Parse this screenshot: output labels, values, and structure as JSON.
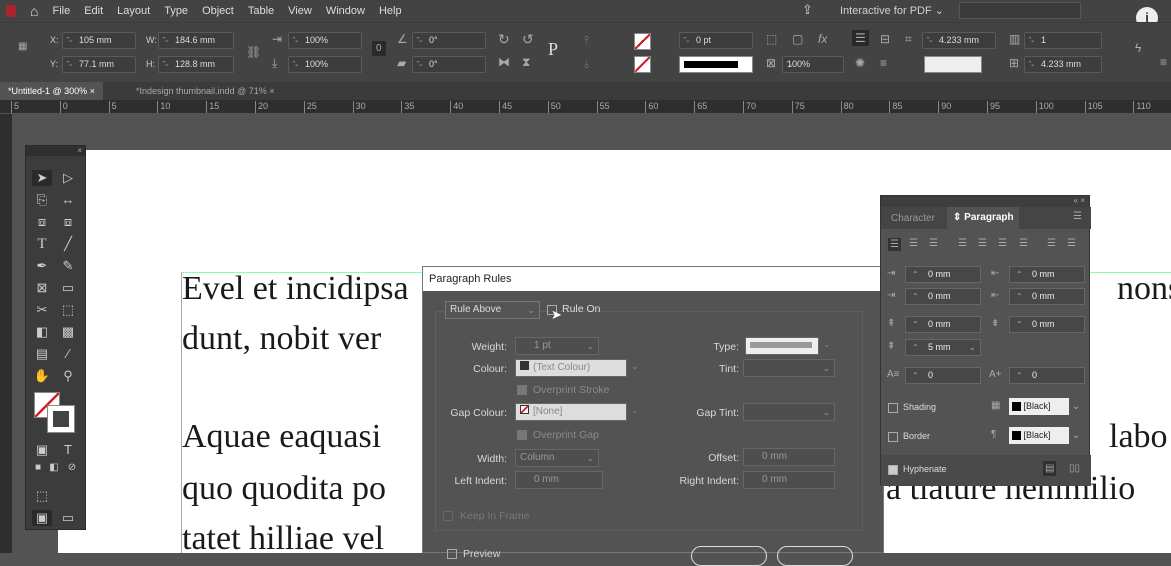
{
  "menubar": {
    "items": [
      "File",
      "Edit",
      "Layout",
      "Type",
      "Object",
      "Table",
      "View",
      "Window",
      "Help"
    ],
    "workspace": "Interactive for PDF"
  },
  "control": {
    "x": "105 mm",
    "y": "77.1 mm",
    "w": "184.6 mm",
    "h": "128.8 mm",
    "x_label": "X:",
    "y_label": "Y:",
    "w_label": "W:",
    "h_label": "H:",
    "scale_x": "100%",
    "scale_y": "100%",
    "rotate": "0°",
    "shear": "0°",
    "stroke_weight": "0 pt",
    "opacity": "100%",
    "gutter": "4.233 mm",
    "columns": "1",
    "col_gutter": "4.233 mm"
  },
  "tabs": [
    {
      "label": "*Untitled-1 @ 300%",
      "active": true
    },
    {
      "label": "*Indesign thumbnail.indd @ 71%",
      "active": false
    }
  ],
  "ruler": [
    "5",
    "0",
    "5",
    "10",
    "15",
    "20",
    "25",
    "30",
    "35",
    "40",
    "45",
    "50",
    "55",
    "60",
    "65",
    "70",
    "75",
    "80",
    "85",
    "90",
    "95",
    "100",
    "105",
    "110"
  ],
  "document": {
    "lines_left": [
      "Evel et incidipsa",
      "dunt, nobit ver",
      "Aquae eaquasi",
      "quo quodita po",
      "tatet hilliae vel"
    ],
    "lines_right": [
      "nons",
      "labo",
      "a tiature henimilio"
    ]
  },
  "dialog": {
    "title": "Paragraph Rules",
    "rule_select": "Rule Above",
    "rule_on": "Rule On",
    "weight_label": "Weight:",
    "weight": "1 pt",
    "colour_label": "Colour:",
    "colour": "(Text Colour)",
    "overprint_stroke": "Overprint Stroke",
    "gap_colour_label": "Gap Colour:",
    "gap_colour": "[None]",
    "overprint_gap": "Overprint Gap",
    "width_label": "Width:",
    "width": "Column",
    "left_indent_label": "Left Indent:",
    "left_indent": "0 mm",
    "type_label": "Type:",
    "tint_label": "Tint:",
    "gap_tint_label": "Gap Tint:",
    "offset_label": "Offset:",
    "offset": "0 mm",
    "right_indent_label": "Right Indent:",
    "right_indent": "0 mm",
    "keep_in_frame": "Keep In Frame",
    "preview": "Preview"
  },
  "panel": {
    "tab_character": "Character",
    "tab_paragraph": "Paragraph",
    "left_indent": "0 mm",
    "right_indent": "0 mm",
    "first_line": "0 mm",
    "last_line": "0 mm",
    "space_before": "0 mm",
    "space_after": "0 mm",
    "baseline": "5 mm",
    "drop_lines": "0",
    "drop_chars": "0",
    "shading": "Shading",
    "shading_colour": "[Black]",
    "border": "Border",
    "border_colour": "[Black]",
    "hyphenate": "Hyphenate"
  },
  "colors": {
    "accent": "#d2202f"
  }
}
